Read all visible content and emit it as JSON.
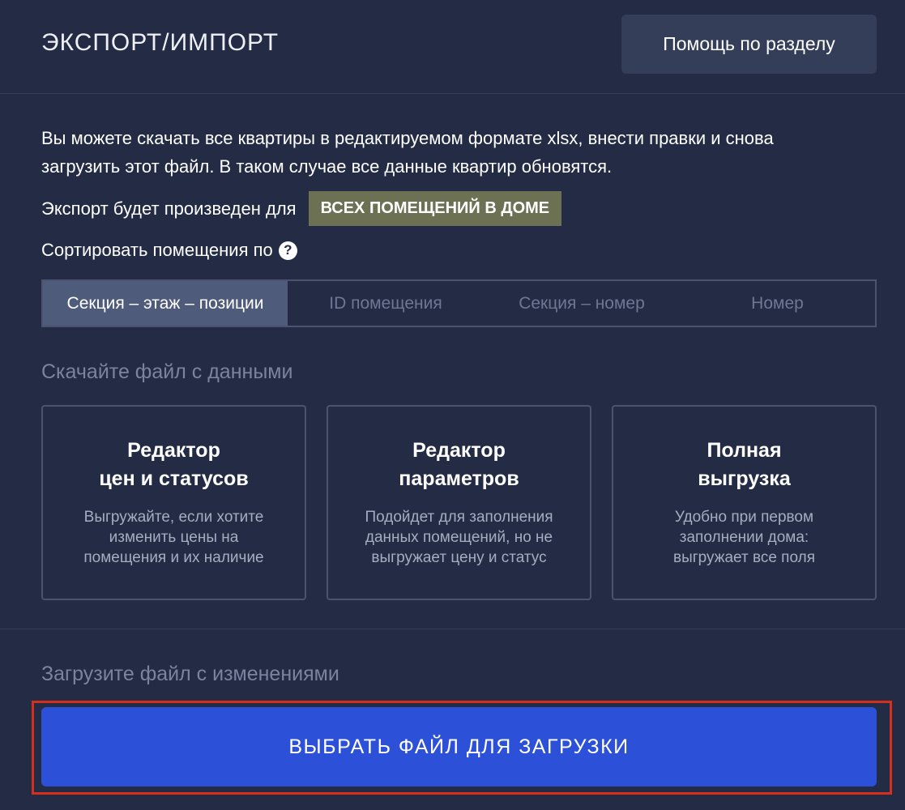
{
  "header": {
    "title": "ЭКСПОРТ/ИМПОРТ",
    "help_label": "Помощь по разделу"
  },
  "description": {
    "line1": "Вы можете скачать все квартиры в редактируемом формате xlsx, внести правки и снова",
    "line2": "загрузить этот файл. В таком случае все данные квартир обновятся."
  },
  "export": {
    "label": "Экспорт будет произведен для",
    "scope": "ВСЕХ ПОМЕЩЕНИЙ В ДОМЕ"
  },
  "sort": {
    "label": "Сортировать помещения по",
    "help_icon": "question-circle-icon",
    "options": [
      {
        "label": "Секция – этаж – позиции",
        "active": true
      },
      {
        "label": "ID помещения",
        "active": false
      },
      {
        "label": "Секция – номер",
        "active": false
      },
      {
        "label": "Номер",
        "active": false
      }
    ]
  },
  "download": {
    "heading": "Скачайте файл с данными",
    "cards": [
      {
        "title_lines": [
          "Редактор",
          "цен и статусов"
        ],
        "desc_lines": [
          "Выгружайте, если хотите",
          "изменить цены на",
          "помещения и их наличие"
        ]
      },
      {
        "title_lines": [
          "Редактор",
          "параметров"
        ],
        "desc_lines": [
          "Подойдет для заполнения",
          "данных помещений, но не",
          "выгружает цену и статус"
        ]
      },
      {
        "title_lines": [
          "Полная",
          "выгрузка"
        ],
        "desc_lines": [
          "Удобно при первом",
          "заполнении дома:",
          "выгружает все поля"
        ]
      }
    ]
  },
  "upload": {
    "heading": "Загрузите файл с изменениями",
    "button_label": "ВЫБРАТЬ ФАЙЛ ДЛЯ ЗАГРУЗКИ"
  },
  "colors": {
    "background": "#232b45",
    "accent": "#2c50d8",
    "badge": "#6d7154",
    "highlight": "#d4301d"
  }
}
